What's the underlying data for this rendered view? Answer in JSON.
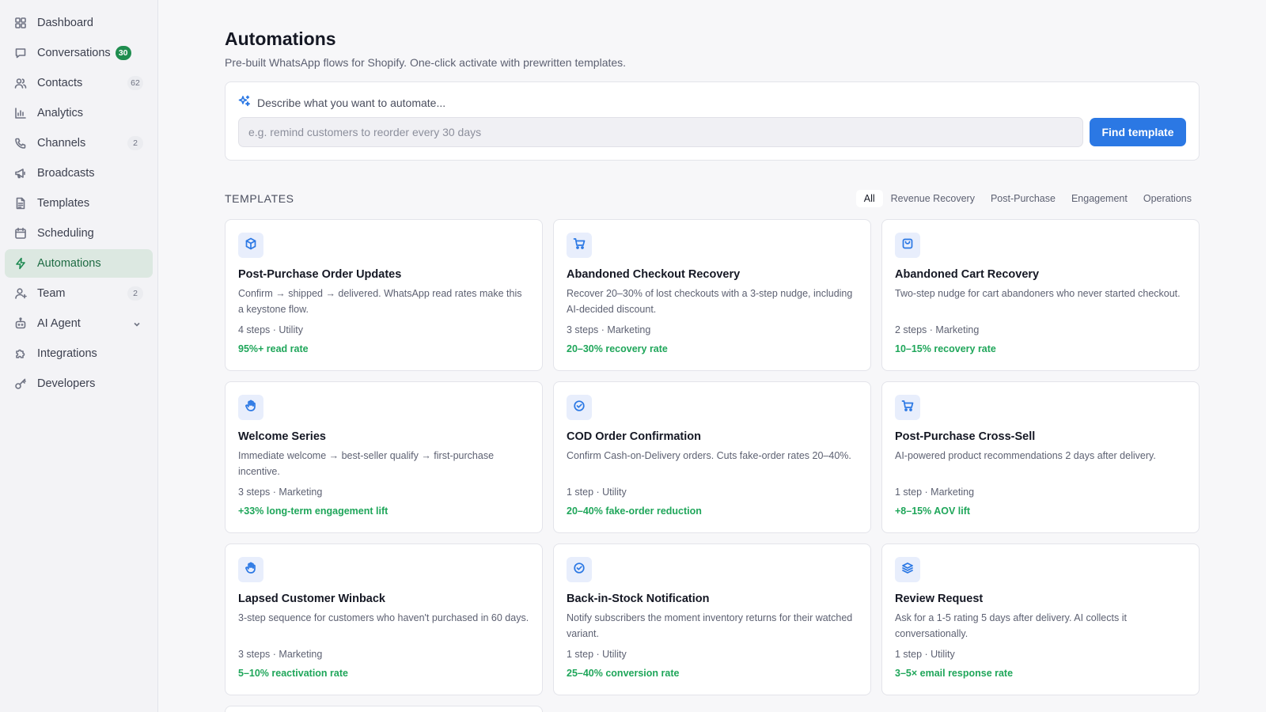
{
  "sidebar": {
    "items": [
      {
        "label": "Dashboard",
        "icon": "grid-icon"
      },
      {
        "label": "Conversations",
        "icon": "chat-icon",
        "badge": "30"
      },
      {
        "label": "Contacts",
        "icon": "users-icon",
        "count": "62"
      },
      {
        "label": "Analytics",
        "icon": "bar-chart-icon"
      },
      {
        "label": "Channels",
        "icon": "phone-icon",
        "count": "2"
      },
      {
        "label": "Broadcasts",
        "icon": "megaphone-icon"
      },
      {
        "label": "Templates",
        "icon": "document-icon"
      },
      {
        "label": "Scheduling",
        "icon": "calendar-icon"
      },
      {
        "label": "Automations",
        "icon": "bolt-icon",
        "active": true
      },
      {
        "label": "Team",
        "icon": "user-icon",
        "count": "2"
      },
      {
        "label": "AI Agent",
        "icon": "robot-icon"
      },
      {
        "label": "Integrations",
        "icon": "puzzle-icon"
      },
      {
        "label": "Developers",
        "icon": "key-icon"
      }
    ]
  },
  "header": {
    "title": "Automations",
    "subtitle": "Pre-built WhatsApp flows for Shopify. One-click activate with prewritten templates."
  },
  "search": {
    "prompt": "Describe what you want to automate...",
    "placeholder": "e.g. remind customers to reorder every 30 days",
    "value": "",
    "button": "Find template"
  },
  "templates": {
    "heading": "TEMPLATES",
    "filters": [
      "All",
      "Revenue Recovery",
      "Post-Purchase",
      "Engagement",
      "Operations"
    ],
    "active_filter": "All",
    "cards": [
      {
        "icon": "box-icon",
        "title": "Post-Purchase Order Updates",
        "desc": "Confirm → shipped → delivered. WhatsApp read rates make this a keystone flow.",
        "meta": "4 steps · Utility",
        "stat": "95%+ read rate"
      },
      {
        "icon": "cart-icon",
        "title": "Abandoned Checkout Recovery",
        "desc": "Recover 20–30% of lost checkouts with a 3-step nudge, including AI-decided discount.",
        "meta": "3 steps · Marketing",
        "stat": "20–30% recovery rate"
      },
      {
        "icon": "shopping-bag-icon",
        "title": "Abandoned Cart Recovery",
        "desc": "Two-step nudge for cart abandoners who never started checkout.",
        "meta": "2 steps · Marketing",
        "stat": "10–15% recovery rate"
      },
      {
        "icon": "hand-wave-icon",
        "title": "Welcome Series",
        "desc": "Immediate welcome → best-seller qualify → first-purchase incentive.",
        "meta": "3 steps · Marketing",
        "stat": "+33% long-term engagement lift"
      },
      {
        "icon": "check-badge-icon",
        "title": "COD Order Confirmation",
        "desc": "Confirm Cash-on-Delivery orders. Cuts fake-order rates 20–40%.",
        "meta": "1 step · Utility",
        "stat": "20–40% fake-order reduction"
      },
      {
        "icon": "cart-icon",
        "title": "Post-Purchase Cross-Sell",
        "desc": "AI-powered product recommendations 2 days after delivery.",
        "meta": "1 step · Marketing",
        "stat": "+8–15% AOV lift"
      },
      {
        "icon": "hand-wave-icon",
        "title": "Lapsed Customer Winback",
        "desc": "3-step sequence for customers who haven't purchased in 60 days.",
        "meta": "3 steps · Marketing",
        "stat": "5–10% reactivation rate"
      },
      {
        "icon": "check-badge-icon",
        "title": "Back-in-Stock Notification",
        "desc": "Notify subscribers the moment inventory returns for their watched variant.",
        "meta": "1 step · Utility",
        "stat": "25–40% conversion rate"
      },
      {
        "icon": "layers-icon",
        "title": "Review Request",
        "desc": "Ask for a 1-5 rating 5 days after delivery. AI collects it conversationally.",
        "meta": "1 step · Utility",
        "stat": "3–5× email response rate"
      }
    ]
  },
  "colors": {
    "accent": "#2b78e4",
    "active_nav_bg": "#dce8e1",
    "badge_green": "#1f8d4f",
    "stat_green": "#1fa65a"
  }
}
